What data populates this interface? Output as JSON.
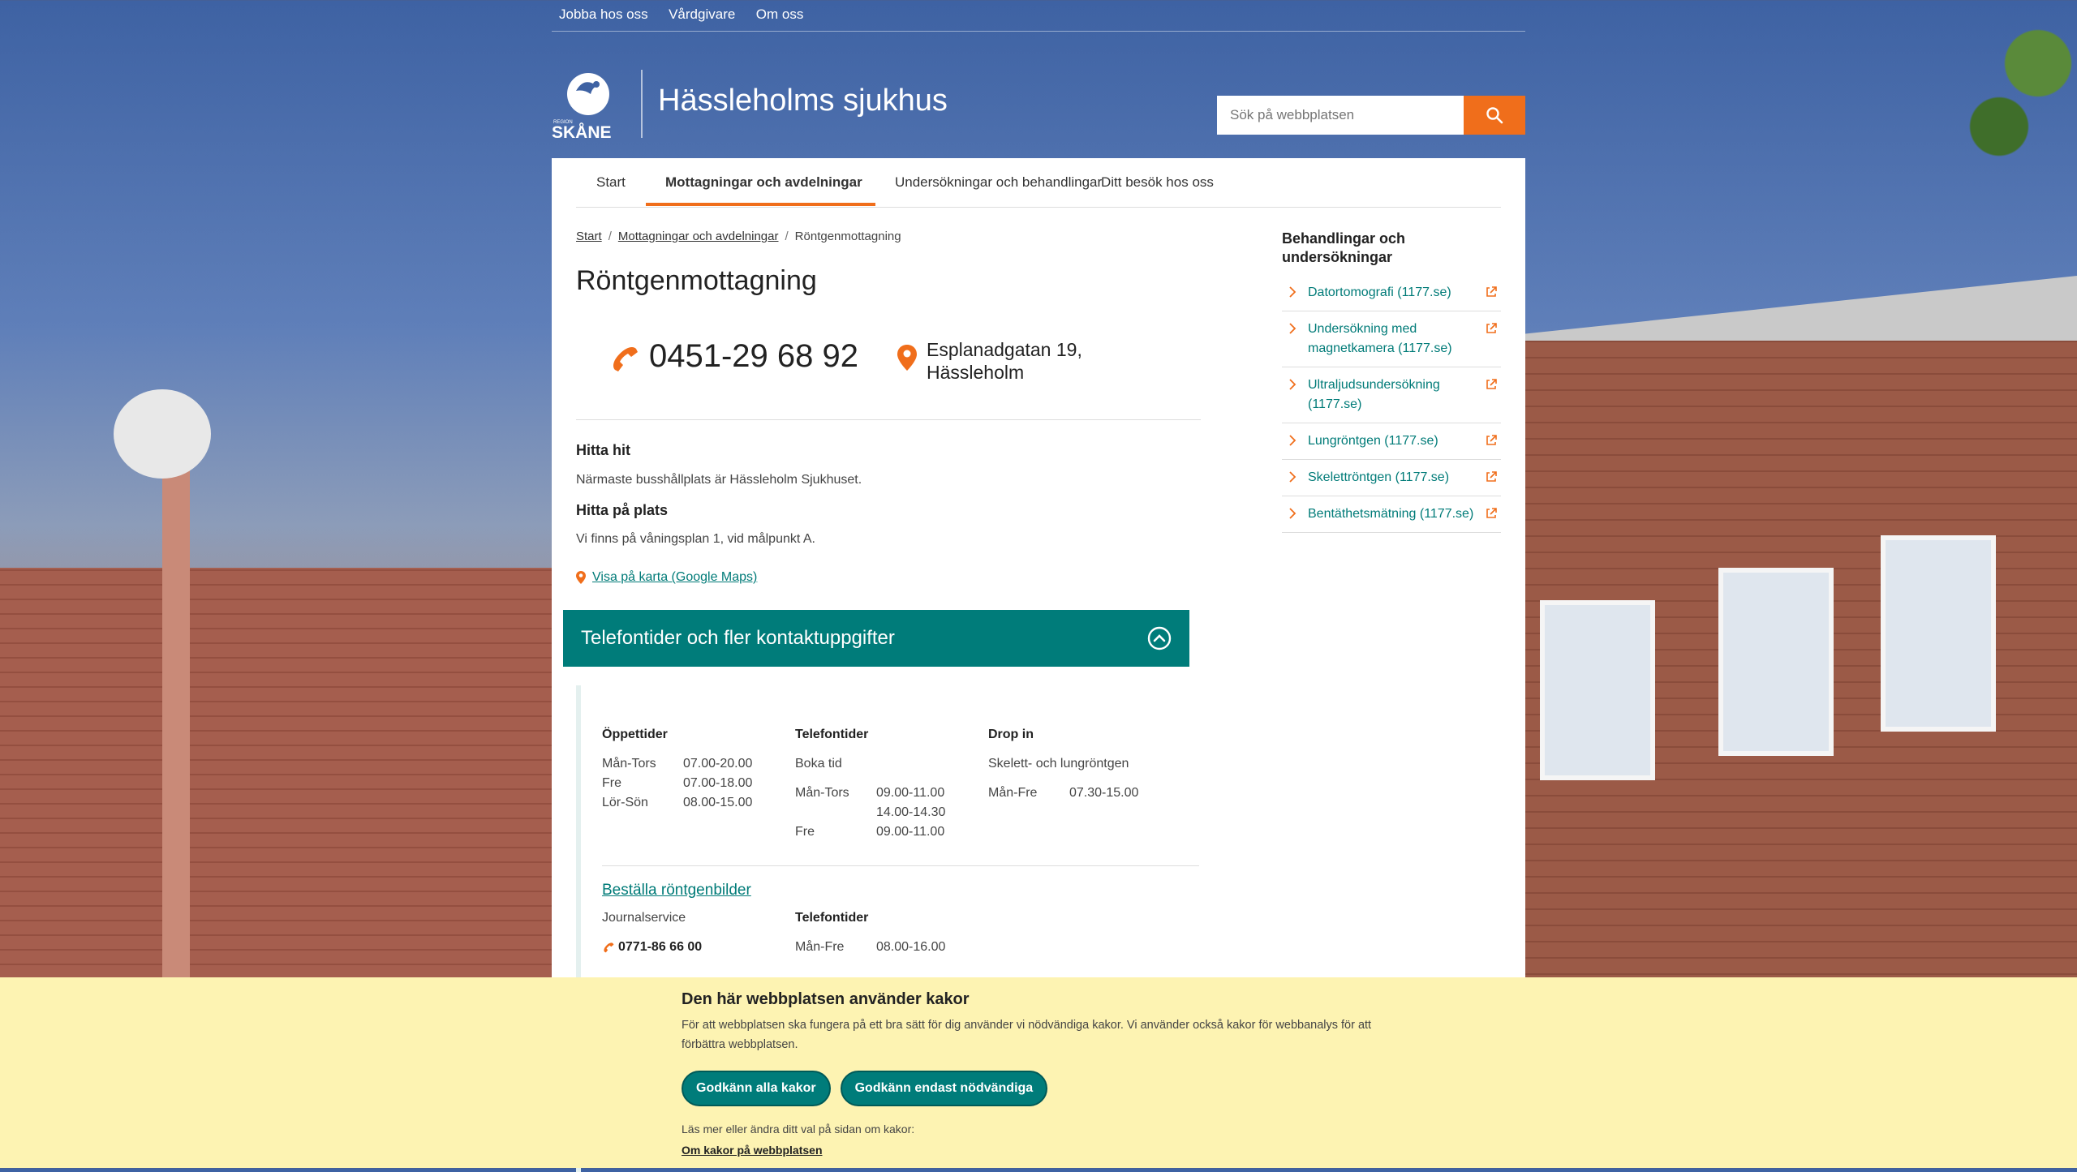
{
  "utility_nav": [
    "Jobba hos oss",
    "Vårdgivare",
    "Om oss"
  ],
  "logo": {
    "small": "REGION",
    "big": "SKÅNE"
  },
  "site_title": "Hässleholms sjukhus",
  "search": {
    "placeholder": "Sök på webbplatsen"
  },
  "main_nav": [
    {
      "label": "Start",
      "active": false
    },
    {
      "label": "Mottagningar och avdelningar",
      "active": true
    },
    {
      "label": "Undersökningar och behandlingar",
      "active": false
    },
    {
      "label": "Ditt besök hos oss",
      "active": false
    }
  ],
  "breadcrumb": [
    "Start",
    "Mottagningar och avdelningar",
    "Röntgenmottagning"
  ],
  "page_title": "Röntgenmottagning",
  "contact": {
    "phone": "0451-29 68 92",
    "address_line1": "Esplanadgatan 19,",
    "address_line2": "Hässleholm"
  },
  "find_here": {
    "heading": "Hitta hit",
    "text": "Närmaste busshållplats är Hässleholm Sjukhuset."
  },
  "find_place": {
    "heading": "Hitta på plats",
    "text": "Vi finns på våningsplan 1, vid målpunkt A."
  },
  "map_link": "Visa på karta (Google Maps)",
  "accordion": {
    "title": "Telefontider och fler kontaktuppgifter"
  },
  "hours": {
    "open": {
      "heading": "Öppettider",
      "rows": [
        [
          "Mån-Tors",
          "07.00-20.00"
        ],
        [
          "Fre",
          "07.00-18.00"
        ],
        [
          "Lör-Sön",
          "08.00-15.00"
        ]
      ]
    },
    "phone": {
      "heading": "Telefontider",
      "sub": "Boka tid",
      "rows": [
        [
          "Mån-Tors",
          "09.00-11.00"
        ],
        [
          "",
          "14.00-14.30"
        ],
        [
          "Fre",
          "09.00-11.00"
        ]
      ]
    },
    "dropin": {
      "heading": "Drop in",
      "sub": "Skelett- och lungröntgen",
      "rows": [
        [
          "Mån-Fre",
          "07.30-15.00"
        ]
      ]
    }
  },
  "order": {
    "link": "Beställa röntgenbilder",
    "service": "Journalservice",
    "phone": "0771-86 66 00",
    "phone_heading": "Telefontider",
    "rows": [
      [
        "Mån-Fre",
        "08.00-16.00"
      ]
    ]
  },
  "sidebar": {
    "heading": "Behandlingar och undersökningar",
    "items": [
      "Datortomografi (1177.se)",
      "Undersökning med magnetkamera (1177.se)",
      "Ultraljudsundersökning (1177.se)",
      "Lungröntgen (1177.se)",
      "Skelettröntgen (1177.se)",
      "Bentäthetsmätning (1177.se)"
    ]
  },
  "cookie": {
    "title": "Den här webbplatsen använder kakor",
    "text": "För att webbplatsen ska fungera på ett bra sätt för dig använder vi nödvändiga kakor. Vi använder också kakor för webbanalys för att förbättra webbplatsen.",
    "accept_all": "Godkänn alla kakor",
    "accept_necessary": "Godkänn endast nödvändiga",
    "more": "Läs mer eller ändra ditt val på sidan om kakor:",
    "link": "Om kakor på webbplatsen"
  },
  "colors": {
    "accent": "#f06e1b",
    "teal": "#007c7a",
    "cookie_bg": "#fdf3b2"
  }
}
